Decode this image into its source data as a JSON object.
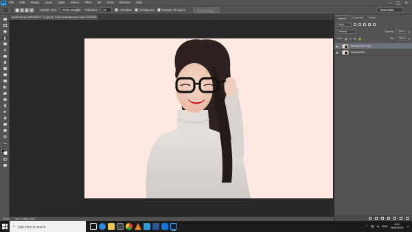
{
  "menubar": {
    "app_icon": "Ps",
    "items": [
      "File",
      "Edit",
      "Image",
      "Layer",
      "Type",
      "Select",
      "Filter",
      "3D",
      "View",
      "Window",
      "Help"
    ],
    "window_controls": [
      "—",
      "□",
      "✕"
    ]
  },
  "options": {
    "sample_size_label": "Sample Size:",
    "sample_size_value": "Point Sample",
    "tolerance_label": "Tolerance:",
    "tolerance_value": "32",
    "anti_alias_label": "Anti-alias",
    "anti_alias_checked": true,
    "contiguous_label": "Contiguous",
    "contiguous_checked": true,
    "sample_all_layers_label": "Sample All Layers",
    "sample_all_layers_checked": false,
    "refine_edge_label": "Refine Edge...",
    "workspace_value": "Essentials"
  },
  "document": {
    "tab_title": "shutterstock_606259097 (1).jpg @ 100% (Background copy, RGB/8#)",
    "tab_close": "×",
    "background_color": "#fde9e2"
  },
  "status": {
    "zoom": "100%",
    "doc_size": "Doc: 2.08M/4.40M"
  },
  "layers_panel": {
    "tabs": [
      "Layers",
      "Channels",
      "Paths"
    ],
    "active_tab": "Layers",
    "kind_label": "Kind",
    "blend_mode": "Normal",
    "opacity_label": "Opacity:",
    "opacity_value": "100%",
    "lock_label": "Lock:",
    "fill_label": "Fill:",
    "fill_value": "100%",
    "layers": [
      {
        "name": "Background copy",
        "selected": true,
        "visible": true
      },
      {
        "name": "Background",
        "selected": false,
        "visible": true
      }
    ]
  },
  "taskbar": {
    "search_placeholder": "Type here to search",
    "apps": [
      "task-view",
      "edge",
      "file-explorer",
      "store",
      "chrome",
      "vlc",
      "vscode",
      "word",
      "mail",
      "photoshop"
    ],
    "tray_language": "ENG",
    "time": "8:31",
    "date": "06/09/2021"
  }
}
